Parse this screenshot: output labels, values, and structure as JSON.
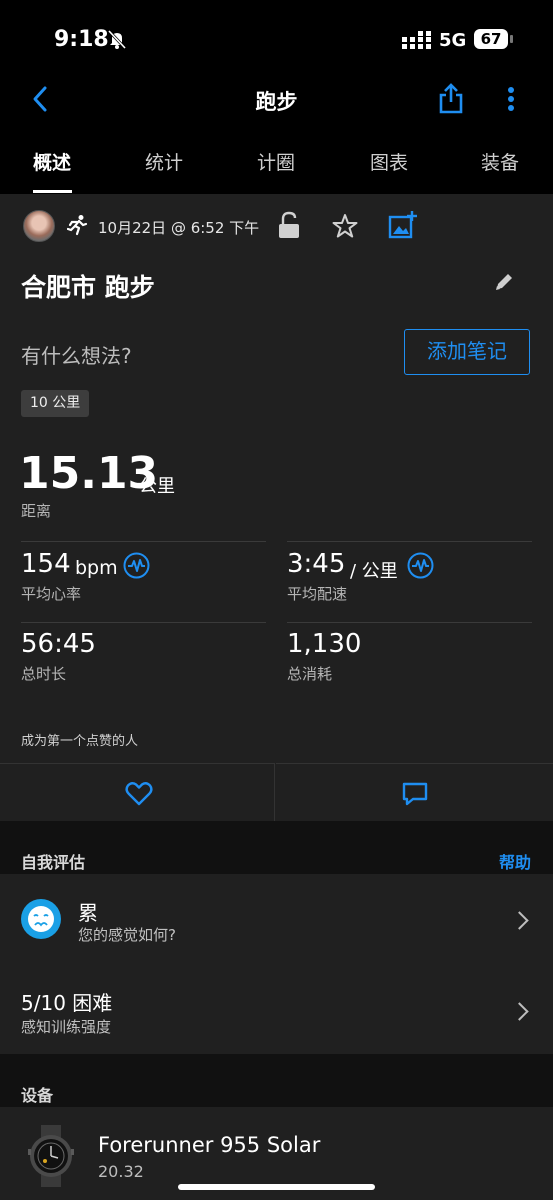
{
  "status_bar": {
    "time": "9:18",
    "network": "5G",
    "battery": "67"
  },
  "header": {
    "title": "跑步"
  },
  "tabs": [
    "概述",
    "统计",
    "计圈",
    "图表",
    "装备"
  ],
  "activity": {
    "date": "10月22日 @ 6:52 下午",
    "title": "合肥市 跑步",
    "thoughts_prompt": "有什么想法?",
    "add_note_label": "添加笔记",
    "tag": "10 公里"
  },
  "metrics": {
    "distance": {
      "value": "15.13",
      "unit": "公里",
      "label": "距离"
    },
    "heart_rate": {
      "value": "154",
      "unit": "bpm",
      "label": "平均心率"
    },
    "pace": {
      "value": "3:45",
      "unit": "/ 公里",
      "label": "平均配速"
    },
    "duration": {
      "value": "56:45",
      "label": "总时长"
    },
    "calories": {
      "value": "1,130",
      "label": "总消耗"
    }
  },
  "likes": {
    "text": "成为第一个点赞的人"
  },
  "self_eval": {
    "section_title": "自我评估",
    "help_label": "帮助",
    "feeling": {
      "title": "累",
      "subtitle": "您的感觉如何?"
    },
    "effort": {
      "title": "5/10 困难",
      "subtitle": "感知训练强度"
    }
  },
  "device": {
    "section_title": "设备",
    "name": "Forerunner 955 Solar",
    "version": "20.32"
  },
  "colors": {
    "accent": "#1f8ef1",
    "background": "#111111",
    "card": "#202020"
  }
}
